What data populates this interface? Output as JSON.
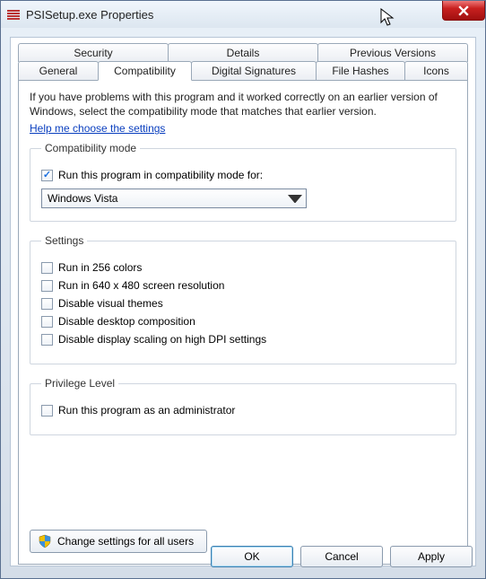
{
  "window": {
    "title": "PSISetup.exe Properties"
  },
  "tabs": {
    "row1": [
      "Security",
      "Details",
      "Previous Versions"
    ],
    "row2": [
      "General",
      "Compatibility",
      "Digital Signatures",
      "File Hashes",
      "Icons"
    ],
    "active": "Compatibility"
  },
  "intro": "If you have problems with this program and it worked correctly on an earlier version of Windows, select the compatibility mode that matches that earlier version.",
  "helpLink": "Help me choose the settings",
  "groups": {
    "compat": {
      "legend": "Compatibility mode",
      "checkboxLabel": "Run this program in compatibility mode for:",
      "checked": true,
      "selected": "Windows Vista"
    },
    "settings": {
      "legend": "Settings",
      "options": [
        {
          "label": "Run in 256 colors",
          "checked": false
        },
        {
          "label": "Run in 640 x 480 screen resolution",
          "checked": false
        },
        {
          "label": "Disable visual themes",
          "checked": false
        },
        {
          "label": "Disable desktop composition",
          "checked": false
        },
        {
          "label": "Disable display scaling on high DPI settings",
          "checked": false
        }
      ]
    },
    "privilege": {
      "legend": "Privilege Level",
      "label": "Run this program as an administrator",
      "checked": false
    }
  },
  "changeAllUsers": "Change settings for all users",
  "buttons": {
    "ok": "OK",
    "cancel": "Cancel",
    "apply": "Apply"
  }
}
